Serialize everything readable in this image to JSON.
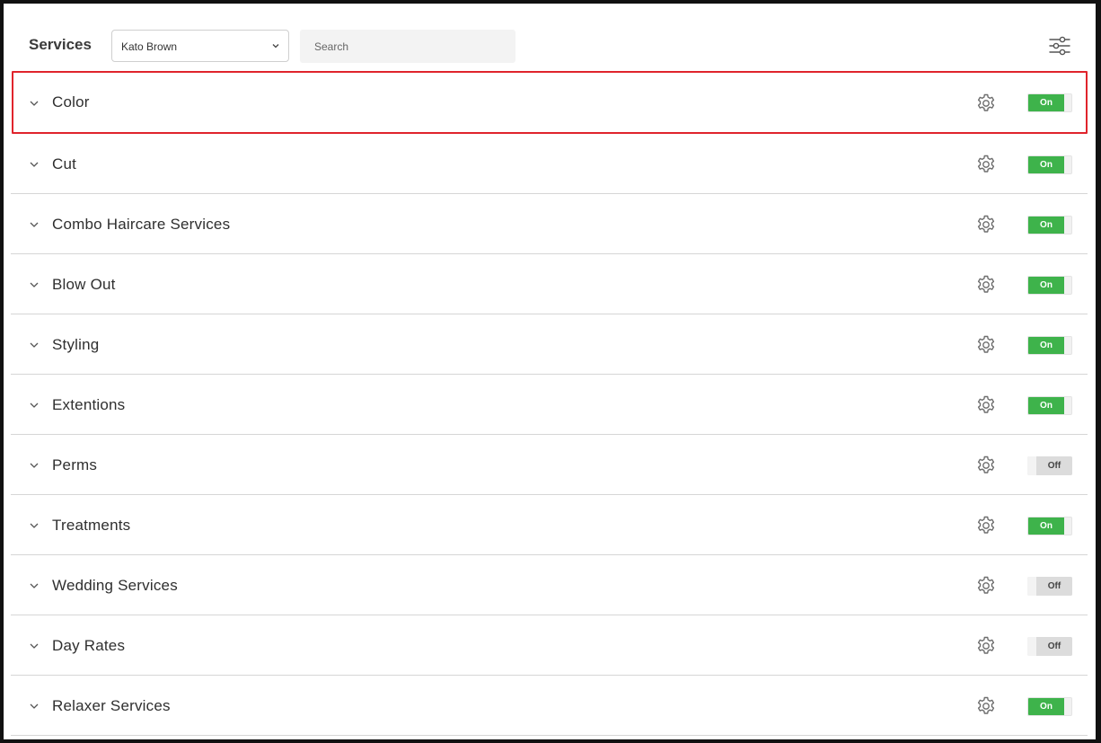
{
  "header": {
    "title": "Services",
    "staff_select": {
      "value": "Kato Brown"
    },
    "search": {
      "placeholder": "Search",
      "value": ""
    }
  },
  "icons": {
    "filter": "sliders-icon",
    "row_expand": "chevron-down-icon",
    "row_settings": "gear-icon"
  },
  "colors": {
    "toggle_on": "#3eb34b",
    "toggle_off": "#dcdcdc",
    "selection_outline": "#e0242c"
  },
  "services": [
    {
      "label": "Color",
      "toggle": "On",
      "selected": true
    },
    {
      "label": "Cut",
      "toggle": "On",
      "selected": false
    },
    {
      "label": "Combo Haircare Services",
      "toggle": "On",
      "selected": false
    },
    {
      "label": "Blow Out",
      "toggle": "On",
      "selected": false
    },
    {
      "label": "Styling",
      "toggle": "On",
      "selected": false
    },
    {
      "label": "Extentions",
      "toggle": "On",
      "selected": false
    },
    {
      "label": "Perms",
      "toggle": "Off",
      "selected": false
    },
    {
      "label": "Treatments",
      "toggle": "On",
      "selected": false
    },
    {
      "label": "Wedding Services",
      "toggle": "Off",
      "selected": false
    },
    {
      "label": "Day Rates",
      "toggle": "Off",
      "selected": false
    },
    {
      "label": "Relaxer Services",
      "toggle": "On",
      "selected": false
    }
  ]
}
